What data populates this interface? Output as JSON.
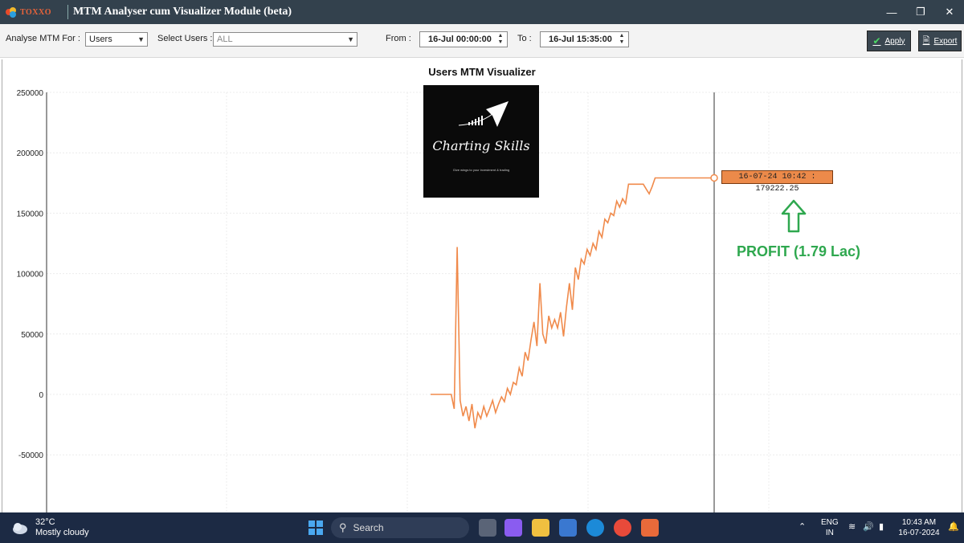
{
  "window": {
    "brand": "TOXXO",
    "title": "MTM Analyser cum Visualizer Module (beta)",
    "controls": {
      "minimize": "—",
      "maximize": "❐",
      "close": "✕"
    }
  },
  "toolbar": {
    "analyse_label": "Analyse MTM For :",
    "analyse_value": "Users",
    "users_label": "Select Users :",
    "users_value": "ALL",
    "from_label": "From :",
    "from_value": "16-Jul 00:00:00",
    "to_label": "To :",
    "to_value": "16-Jul 15:35:00",
    "apply_label": "Apply",
    "export_label": "Export"
  },
  "watermark": {
    "title": "Charting Skills",
    "tagline": "Give wings to your investment & trading"
  },
  "annotation": {
    "tooltip": "16-07-24 10:42 : 179222.25",
    "profit": "PROFIT (1.79 Lac)"
  },
  "chart_data": {
    "type": "line",
    "title": "Users MTM Visualizer",
    "xlabel": "",
    "ylabel": "",
    "ylim": [
      -95000,
      250000
    ],
    "yticks": [
      250000,
      200000,
      150000,
      100000,
      50000,
      0,
      -50000
    ],
    "grid": true,
    "line_color": "#f08a4b",
    "cursor_value": 179222.25,
    "series": [
      {
        "values": [
          0,
          0,
          0,
          0,
          0,
          0,
          0,
          0,
          -12000,
          122000,
          -5000,
          -18000,
          -10000,
          -22000,
          -8000,
          -28000,
          -15000,
          -20000,
          -10000,
          -18000,
          -12000,
          -5000,
          -15000,
          -8000,
          -2000,
          -6000,
          5000,
          0,
          10000,
          8000,
          22000,
          15000,
          35000,
          28000,
          45000,
          60000,
          40000,
          92000,
          50000,
          42000,
          65000,
          55000,
          62000,
          55000,
          68000,
          48000,
          72000,
          92000,
          70000,
          105000,
          95000,
          112000,
          108000,
          120000,
          115000,
          125000,
          120000,
          135000,
          130000,
          145000,
          142000,
          150000,
          148000,
          160000,
          155000,
          162000,
          158000,
          174000,
          174000,
          174000,
          174000,
          174000,
          174000,
          170000,
          166000,
          172000,
          179222,
          179222,
          179222,
          179222,
          179222,
          179222,
          179222,
          179222,
          179222,
          179222,
          179222,
          179222,
          179222,
          179222,
          179222,
          179222,
          179222,
          179222,
          179222,
          179222,
          179222
        ]
      }
    ]
  },
  "taskbar": {
    "temp": "32°C",
    "weather": "Mostly cloudy",
    "search": "Search",
    "lang1": "ENG",
    "lang2": "IN",
    "time": "10:43 AM",
    "date": "16-07-2024"
  }
}
